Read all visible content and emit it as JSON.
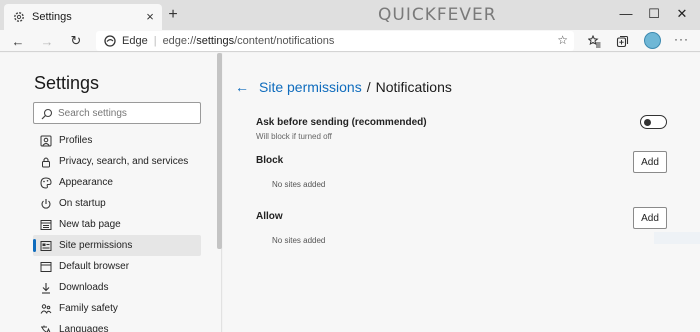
{
  "browser": {
    "tab_title": "Settings",
    "tab_close": "×",
    "new_tab": "+",
    "brand": "QUICKFEVER",
    "window_controls": {
      "minimize": "—",
      "maximize": "☐",
      "close": "✕"
    },
    "nav": {
      "back": "←",
      "forward": "→",
      "refresh": "↻"
    },
    "address": {
      "site_label": "Edge",
      "url_prefix": "edge://",
      "url_path": "settings",
      "url_rest": "/content/notifications"
    },
    "favorite_star": "☆",
    "menu": "···"
  },
  "sidebar": {
    "title": "Settings",
    "search_placeholder": "Search settings",
    "items": [
      {
        "label": "Profiles",
        "icon": "profile-icon"
      },
      {
        "label": "Privacy, search, and services",
        "icon": "lock-icon"
      },
      {
        "label": "Appearance",
        "icon": "palette-icon"
      },
      {
        "label": "On startup",
        "icon": "power-icon"
      },
      {
        "label": "New tab page",
        "icon": "newtab-grid-icon"
      },
      {
        "label": "Site permissions",
        "icon": "site-permissions-icon",
        "active": true
      },
      {
        "label": "Default browser",
        "icon": "browser-window-icon"
      },
      {
        "label": "Downloads",
        "icon": "download-icon"
      },
      {
        "label": "Family safety",
        "icon": "family-icon"
      },
      {
        "label": "Languages",
        "icon": "languages-icon"
      }
    ]
  },
  "content": {
    "back_arrow": "←",
    "breadcrumb_parent": "Site permissions",
    "breadcrumb_sep": "/",
    "breadcrumb_current": "Notifications",
    "ask_title": "Ask before sending (recommended)",
    "ask_subtitle": "Will block if turned off",
    "ask_enabled": false,
    "block": {
      "title": "Block",
      "add_label": "Add",
      "empty_text": "No sites added"
    },
    "allow": {
      "title": "Allow",
      "add_label": "Add",
      "empty_text": "No sites added"
    }
  },
  "colors": {
    "accent": "#0f6cbd",
    "titlebar": "#dfdfdf",
    "page_bg": "#f7f7f7"
  }
}
